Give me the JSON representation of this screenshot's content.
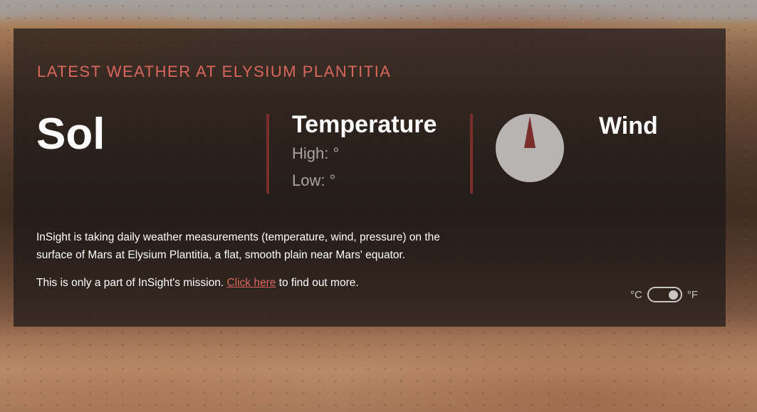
{
  "heading": "LATEST WEATHER AT ELYSIUM PLANTITIA",
  "sol": {
    "label": "Sol"
  },
  "temperature": {
    "title": "Temperature",
    "high": "High: °",
    "low": "Low: °"
  },
  "wind": {
    "title": "Wind",
    "compass_icon": "compass-icon"
  },
  "description": "InSight is taking daily weather measurements (temperature, wind, pressure) on the surface of Mars at Elysium Plantitia, a flat, smooth plain near Mars' equator.",
  "mission": {
    "prefix": "This is only a part of InSight's mission. ",
    "link_label": "Click here",
    "suffix": " to find out more."
  },
  "units": {
    "celsius": "°C",
    "fahrenheit": "°F",
    "selected": "°F"
  },
  "colors": {
    "accent": "#d9675e",
    "divider": "#7a2f2c",
    "panel": "#1c1816"
  }
}
